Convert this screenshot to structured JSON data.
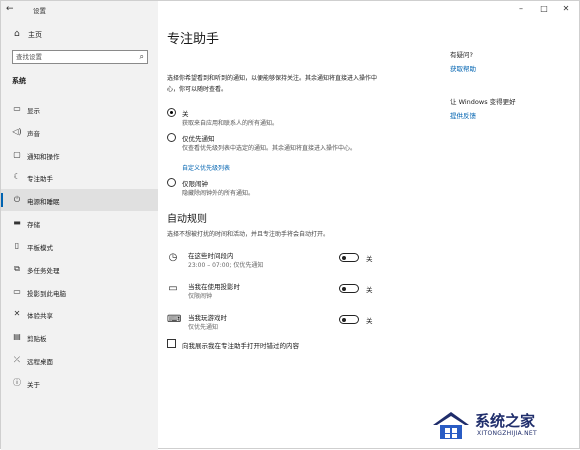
{
  "window": {
    "title": "设置",
    "minimize": "–",
    "maximize": "□",
    "close": "✕"
  },
  "sidebar": {
    "home_label": "主页",
    "search_placeholder": "查找设置",
    "section_title": "系统",
    "items": [
      {
        "label": "显示",
        "icon": "monitor-icon"
      },
      {
        "label": "声音",
        "icon": "speaker-icon"
      },
      {
        "label": "通知和操作",
        "icon": "notification-icon"
      },
      {
        "label": "专注助手",
        "icon": "moon-icon",
        "active": true
      },
      {
        "label": "电源和睡眠",
        "icon": "power-icon"
      },
      {
        "label": "存储",
        "icon": "storage-icon"
      },
      {
        "label": "平板模式",
        "icon": "tablet-icon"
      },
      {
        "label": "多任务处理",
        "icon": "multitask-icon"
      },
      {
        "label": "投影到此电脑",
        "icon": "project-icon"
      },
      {
        "label": "体验共享",
        "icon": "share-icon"
      },
      {
        "label": "剪贴板",
        "icon": "clipboard-icon"
      },
      {
        "label": "远程桌面",
        "icon": "remote-icon"
      },
      {
        "label": "关于",
        "icon": "info-icon"
      }
    ]
  },
  "main": {
    "title": "专注助手",
    "intro": "选择你希望看到和听到的通知，以便能够保持关注。其余通知将直接进入操作中心，你可以随时查看。",
    "options": [
      {
        "label": "关",
        "desc": "获取来自应用和联系人的所有通知。",
        "checked": true
      },
      {
        "label": "仅优先通知",
        "desc": "仅查看优先级列表中选定的通知。其余通知将直接进入操作中心。",
        "link": "自定义优先级列表",
        "checked": false
      },
      {
        "label": "仅限闹钟",
        "desc": "隐藏除闹钟外的所有通知。",
        "checked": false
      }
    ],
    "auto_rules_title": "自动规则",
    "auto_rules_desc": "选择不想被打扰的时间和活动，并且专注助手将会自动打开。",
    "rules": [
      {
        "name": "在这些时间段内",
        "sub": "23:00 – 07:00; 仅优先通知",
        "state": "关",
        "icon": "clock-icon"
      },
      {
        "name": "当我在使用投影时",
        "sub": "仅限闹钟",
        "state": "关",
        "icon": "display-icon"
      },
      {
        "name": "当我玩游戏时",
        "sub": "仅优先通知",
        "state": "关",
        "icon": "gamepad-icon"
      }
    ],
    "summary_checkbox": "向我展示我在专注助手打开时错过的内容"
  },
  "aside": {
    "question": "有疑问?",
    "help_link": "获取帮助",
    "improve": "让 Windows 变得更好",
    "feedback_link": "提供反馈"
  },
  "watermark": {
    "brand": "系统之家",
    "url": "XITONGZHIJIA.NET"
  }
}
